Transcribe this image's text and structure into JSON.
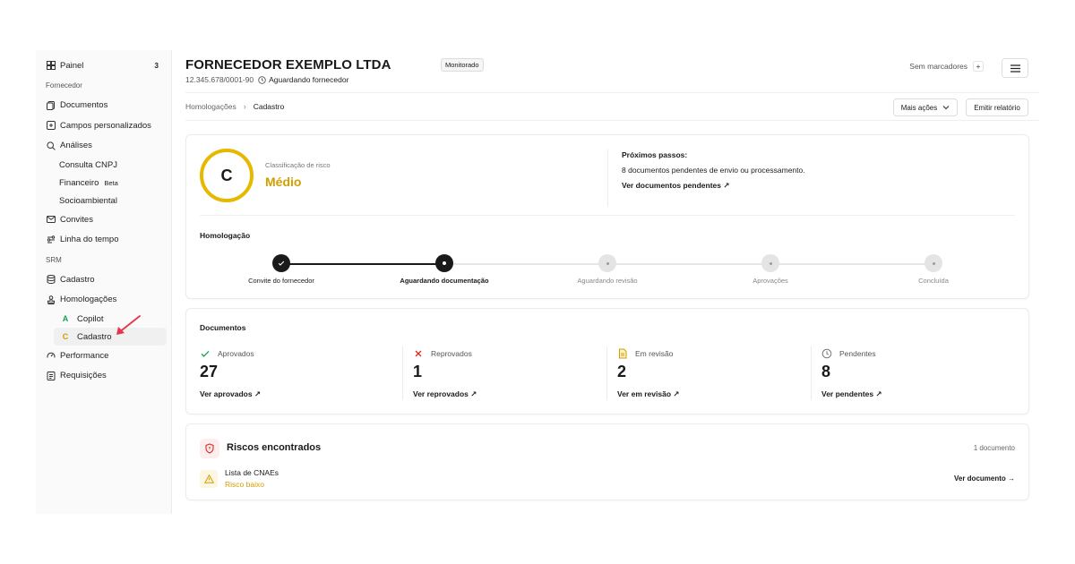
{
  "sidebar": {
    "panel": {
      "label": "Painel",
      "count": "3"
    },
    "section_supplier": "Fornecedor",
    "supplier_items": [
      {
        "label": "Documentos",
        "icon": "documents-icon"
      },
      {
        "label": "Campos personalizados",
        "icon": "custom-fields-icon"
      },
      {
        "label": "Análises",
        "icon": "search-icon"
      }
    ],
    "analysis_sub": [
      {
        "label": "Consulta CNPJ"
      },
      {
        "label": "Financeiro",
        "badge": "Beta"
      },
      {
        "label": "Socioambiental"
      }
    ],
    "more_items": [
      {
        "label": "Convites",
        "icon": "mail-icon"
      },
      {
        "label": "Linha do tempo",
        "icon": "timeline-icon"
      }
    ],
    "section_srm": "SRM",
    "srm_items": [
      {
        "label": "Cadastro",
        "icon": "database-icon"
      },
      {
        "label": "Homologações",
        "icon": "stamp-icon"
      }
    ],
    "homolog_sub": [
      {
        "letter": "A",
        "label": "Copilot",
        "color": "#16a34a"
      },
      {
        "letter": "C",
        "label": "Cadastro",
        "color": "#d19e00"
      }
    ],
    "bottom_items": [
      {
        "label": "Performance",
        "icon": "gauge-icon"
      },
      {
        "label": "Requisições",
        "icon": "requests-icon"
      }
    ]
  },
  "header": {
    "company": "FORNECEDOR EXEMPLO LTDA",
    "status_tag": "Monitorado",
    "cnpj": "12.345.678/0001-90",
    "awaiting": "Aguardando fornecedor",
    "markers": "Sem marcadores",
    "markers_add": "+"
  },
  "breadcrumb": {
    "parent": "Homologações",
    "sep": "›",
    "current": "Cadastro"
  },
  "actions": {
    "more": "Mais ações",
    "report": "Emitir relatório"
  },
  "risk": {
    "grade": "C",
    "label": "Classificação de risco",
    "value": "Médio",
    "next_title": "Próximos passos:",
    "next_text": "8 documentos pendentes de envio ou processamento.",
    "next_link": "Ver documentos pendentes ↗"
  },
  "homologation": {
    "title": "Homologação",
    "steps": [
      {
        "label": "Convite do fornecedor",
        "state": "done"
      },
      {
        "label": "Aguardando documentação",
        "state": "current"
      },
      {
        "label": "Aguardando revisão",
        "state": "pending"
      },
      {
        "label": "Aprovações",
        "state": "pending"
      },
      {
        "label": "Concluída",
        "state": "pending"
      }
    ]
  },
  "documents": {
    "title": "Documentos",
    "stats": [
      {
        "label": "Aprovados",
        "value": "27",
        "link": "Ver aprovados ↗",
        "icon": "check-icon",
        "color": "#16a34a"
      },
      {
        "label": "Reprovados",
        "value": "1",
        "link": "Ver reprovados ↗",
        "icon": "x-icon",
        "color": "#dc2626"
      },
      {
        "label": "Em revisão",
        "value": "2",
        "link": "Ver em revisão ↗",
        "icon": "file-review-icon",
        "color": "#d19e00"
      },
      {
        "label": "Pendentes",
        "value": "8",
        "link": "Ver pendentes ↗",
        "icon": "clock-icon",
        "color": "#777777"
      }
    ]
  },
  "risks_found": {
    "title": "Riscos encontrados",
    "count": "1 documento",
    "items": [
      {
        "name": "Lista de CNAEs",
        "level": "Risco baixo",
        "link": "Ver documento →"
      }
    ]
  }
}
